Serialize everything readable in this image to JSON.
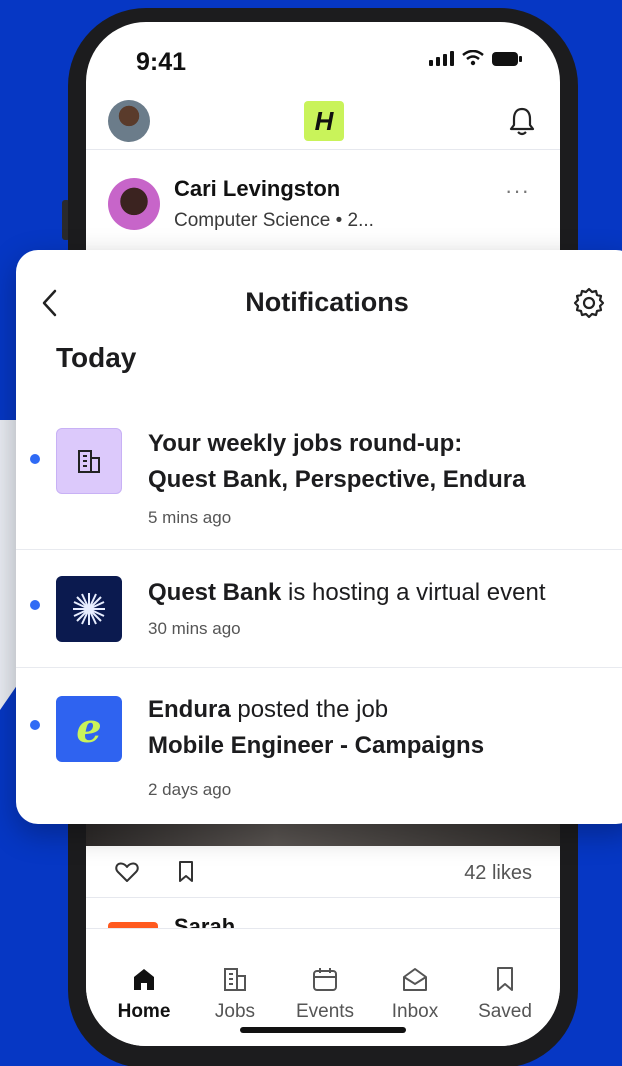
{
  "status_bar": {
    "time": "9:41",
    "icons": [
      "cellular-signal-icon",
      "wifi-icon",
      "battery-icon"
    ]
  },
  "app_header": {
    "logo": "H"
  },
  "feed": {
    "card": {
      "name": "Cari Levingston",
      "subtitle": "Computer Science • 2..."
    },
    "post_actions": {
      "likes": "42 likes"
    },
    "next_post": {
      "name_partial": "Sarah"
    }
  },
  "notifications": {
    "title": "Notifications",
    "section": "Today",
    "items": [
      {
        "line1": "Your weekly jobs round-up:",
        "line2": "Quest Bank, Perspective, Endura",
        "time": "5 mins ago",
        "icon": "building-icon",
        "unread": true
      },
      {
        "company": "Quest Bank",
        "text": " is hosting a virtual event",
        "time": "30 mins ago",
        "icon": "quest-bank-logo",
        "unread": true
      },
      {
        "company": "Endura",
        "text": " posted the job",
        "line2": "Mobile Engineer - Campaigns",
        "time": "2 days ago",
        "icon": "endura-logo",
        "logo_letter": "e",
        "unread": true
      }
    ]
  },
  "bottom_nav": {
    "items": [
      {
        "label": "Home",
        "icon": "home-icon",
        "active": true
      },
      {
        "label": "Jobs",
        "icon": "jobs-building-icon",
        "active": false
      },
      {
        "label": "Events",
        "icon": "calendar-icon",
        "active": false
      },
      {
        "label": "Inbox",
        "icon": "inbox-icon",
        "active": false
      },
      {
        "label": "Saved",
        "icon": "bookmark-icon",
        "active": false
      }
    ]
  },
  "colors": {
    "background": "#0637c4",
    "unread_dot": "#2f6af5",
    "logo_green": "#c9f35a",
    "endura_blue": "#2f63f0",
    "quest_navy": "#0b1a4f",
    "jobs_lavender": "#dcc9fb"
  }
}
